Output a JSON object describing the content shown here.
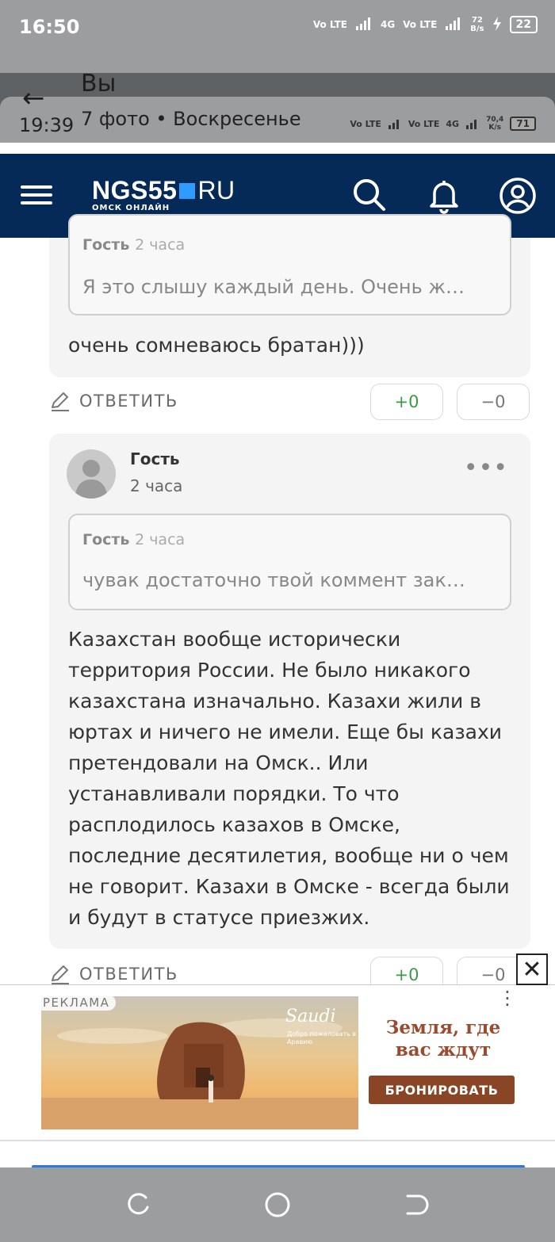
{
  "outer_status": {
    "time": "16:50",
    "net1": "Vo LTE",
    "net2": "4G",
    "net3": "Vo LTE",
    "speed_value": "72",
    "speed_unit": "B/s",
    "battery": "22"
  },
  "inner_status": {
    "back_label": "←",
    "sender": "Вы",
    "time": "19:39",
    "photo_info": "7 фото • Воскресенье",
    "speed_value": "70,4",
    "speed_unit": "K/s",
    "battery": "71",
    "net_labels": [
      "Vo LTE",
      "Vo LTE",
      "4G"
    ]
  },
  "header": {
    "logo_main": "NGS55",
    "logo_ru": "RU",
    "logo_sub": "ОМСК ОНЛАЙН",
    "colors": {
      "background": "#062a57",
      "logo_square": "#2e9bff"
    }
  },
  "comment1": {
    "quote_author": "Гость",
    "quote_time": "2 часа",
    "quote_text": "Я это слышу каждый день. Очень ж…",
    "text": "очень сомневаюсь братан)))",
    "reply_label": "ОТВЕТИТЬ",
    "plus": "+0",
    "minus": "−0"
  },
  "comment2": {
    "author": "Гость",
    "time": "2 часа",
    "menu": "•••",
    "quote_author": "Гость",
    "quote_time": "2 часа",
    "quote_text": "чувак достаточно твой коммент зак…",
    "text": "Казахстан вообще исторически территория России. Не было никакого казахстана изначально. Казахи жили в юртах и ничего не имели. Еще бы казахи претендовали на Омск.. Или устанавливали порядки. То что расплодилось казахов в Омске, последние десятилетия, вообще ни о чем не говорит. Казахи в Омске - всегда были и будут в статусе приезжих.",
    "reply_label": "ОТВЕТИТЬ",
    "plus": "+0",
    "minus": "−0"
  },
  "ad": {
    "label": "РЕКЛАМА",
    "brand": "Saudi",
    "brand_sub": "Добро пожаловать в Аравию",
    "title": "Земля, где вас ждут",
    "button": "БРОНИРОВАТЬ",
    "close": "✕",
    "menu": "⋮"
  }
}
